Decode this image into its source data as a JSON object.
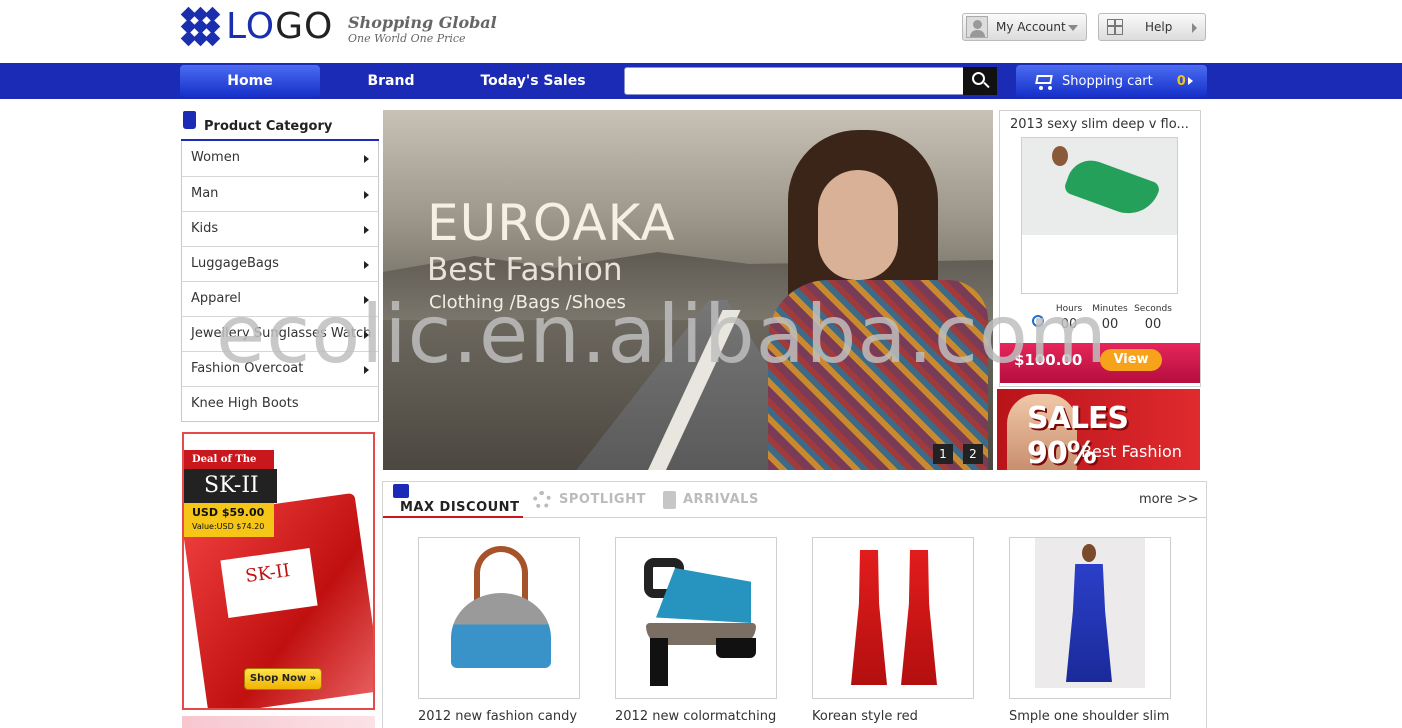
{
  "header": {
    "logo_text_lo": "LO",
    "logo_text_go": "GO",
    "slogan_main": "Shopping Global",
    "slogan_sub": "One World One Price",
    "account_label": "My Account",
    "help_label": "Help"
  },
  "nav": {
    "items": [
      {
        "label": "Home",
        "active": true
      },
      {
        "label": "Brand",
        "active": false
      },
      {
        "label": "Today's Sales",
        "active": false
      }
    ],
    "search_value": "",
    "cart_label": "Shopping cart",
    "cart_count": "0"
  },
  "categories": {
    "title": "Product Category",
    "items": [
      {
        "label": "Women",
        "has_arrow": true
      },
      {
        "label": "Man",
        "has_arrow": true
      },
      {
        "label": "Kids",
        "has_arrow": true
      },
      {
        "label": "LuggageBags",
        "has_arrow": true
      },
      {
        "label": "Apparel",
        "has_arrow": true
      },
      {
        "label": "Jewellery Sunglasses Watch",
        "has_arrow": true
      },
      {
        "label": "Fashion Overcoat",
        "has_arrow": true
      },
      {
        "label": "Knee High Boots",
        "has_arrow": false
      }
    ]
  },
  "deal": {
    "tag": "Deal of The Day",
    "brand": "SK-II",
    "price": "USD $59.00",
    "value": "Value:USD $74.20",
    "pack_text": "SK-II",
    "button": "Shop Now »"
  },
  "banner": {
    "headline": "EUROAKA",
    "subline": "Best Fashion",
    "categories_line": "Clothing /Bags /Shoes",
    "slides": [
      "1",
      "2"
    ]
  },
  "promo": {
    "title": "2013 sexy slim deep v flo...",
    "countdown": {
      "hours_label": "Hours",
      "hours": "00",
      "minutes_label": "Minutes",
      "minutes": "00",
      "seconds_label": "Seconds",
      "seconds": "00"
    },
    "price": "$100.00",
    "button": "View"
  },
  "sale_banner": {
    "headline": "SALES 90%",
    "sub": "Best Fashion"
  },
  "tabs": {
    "items": [
      {
        "label": "MAX DISCOUNT",
        "active": true
      },
      {
        "label": "SPOTLIGHT",
        "active": false
      },
      {
        "label": "ARRIVALS",
        "active": false
      }
    ],
    "more": "more >>"
  },
  "products": [
    {
      "name": "2012 new fashion candy"
    },
    {
      "name": "2012 new colormatching"
    },
    {
      "name": "Korean style red"
    },
    {
      "name": "Smple one shoulder slim"
    }
  ],
  "watermark": "ecolic.en.alibaba.com",
  "colors": {
    "nav_blue": "#1b2bb6",
    "accent_red": "#c8181e",
    "cart_count_yellow": "#f3c21b"
  }
}
